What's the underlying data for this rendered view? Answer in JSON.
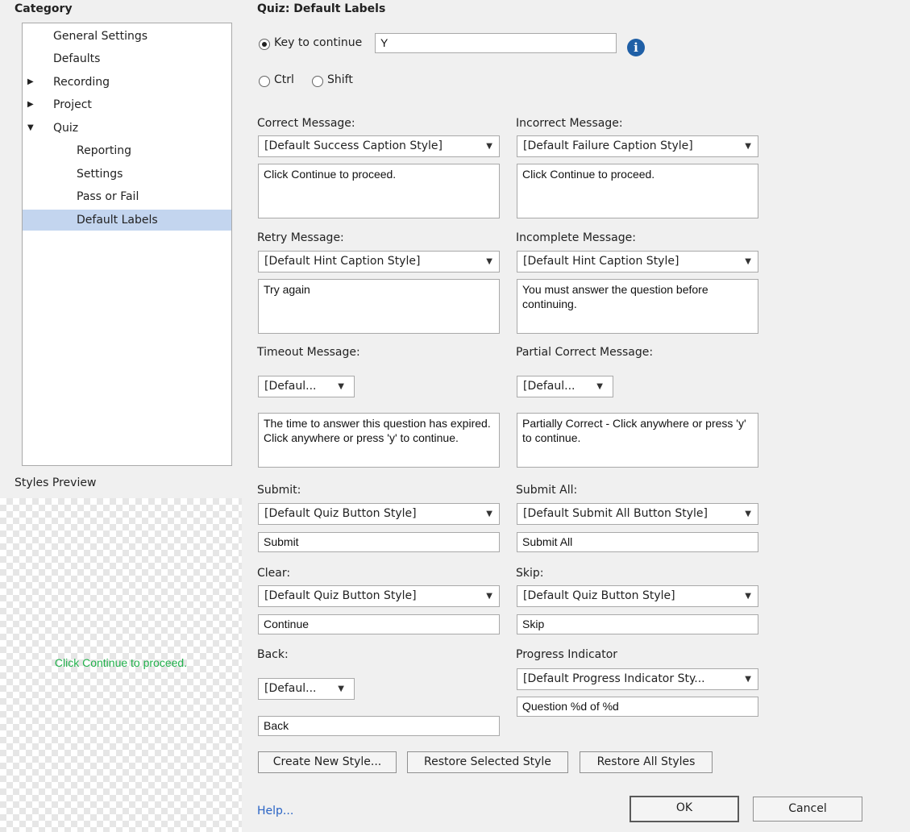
{
  "category": {
    "heading": "Category",
    "items": [
      {
        "label": "General Settings"
      },
      {
        "label": "Defaults"
      },
      {
        "label": "Recording",
        "expander": "▶"
      },
      {
        "label": "Project",
        "expander": "▶"
      },
      {
        "label": "Quiz",
        "expander": "▼"
      },
      {
        "label": "Reporting"
      },
      {
        "label": "Settings"
      },
      {
        "label": "Pass or Fail"
      },
      {
        "label": "Default Labels"
      }
    ]
  },
  "preview": {
    "heading": "Styles Preview",
    "text": "Click Continue to proceed.",
    "text_color": "#22b14c"
  },
  "page": {
    "title": "Quiz: Default Labels",
    "key_to_continue_label": "Key to continue",
    "key_value": "Y",
    "ctrl_label": "Ctrl",
    "shift_label": "Shift",
    "info_glyph": "i"
  },
  "fields": {
    "correct": {
      "label": "Correct Message:",
      "style": "[Default Success Caption Style]",
      "text": "Click Continue to proceed."
    },
    "incorrect": {
      "label": "Incorrect Message:",
      "style": "[Default Failure Caption Style]",
      "text": "Click Continue to proceed."
    },
    "retry": {
      "label": "Retry Message:",
      "style": "[Default Hint Caption Style]",
      "text": "Try again"
    },
    "incomplete": {
      "label": "Incomplete Message:",
      "style": "[Default Hint Caption Style]",
      "text": "You must answer the question before continuing."
    },
    "timeout": {
      "label": "Timeout Message:",
      "style": "[Defaul...",
      "text": "The time to answer this question has expired. Click anywhere or press 'y' to continue."
    },
    "partial": {
      "label": "Partial Correct Message:",
      "style": "[Defaul...",
      "text": "Partially Correct - Click anywhere or press 'y' to continue."
    },
    "submit": {
      "label": "Submit:",
      "style": "[Default Quiz Button Style]",
      "text": "Submit"
    },
    "submit_all": {
      "label": "Submit All:",
      "style": "[Default Submit All Button Style]",
      "text": "Submit All"
    },
    "clear": {
      "label": "Clear:",
      "style": "[Default Quiz Button Style]",
      "text": "Continue"
    },
    "skip": {
      "label": "Skip:",
      "style": "[Default Quiz Button Style]",
      "text": "Skip"
    },
    "back": {
      "label": "Back:",
      "style": "[Defaul...",
      "text": "Back"
    },
    "progress": {
      "label": "Progress Indicator",
      "style": "[Default Progress Indicator Sty...",
      "text": "Question %d of %d"
    }
  },
  "buttons": {
    "create_new": "Create New Style...",
    "restore_selected": "Restore Selected Style",
    "restore_all": "Restore All Styles",
    "help": "Help...",
    "ok": "OK",
    "cancel": "Cancel"
  },
  "icons": {
    "dropdown_arrow": "▼",
    "info": "info-icon"
  },
  "colors": {
    "selected_row": "#c3d5ef",
    "link": "#2a64c5",
    "info": "#1f5fa6"
  }
}
